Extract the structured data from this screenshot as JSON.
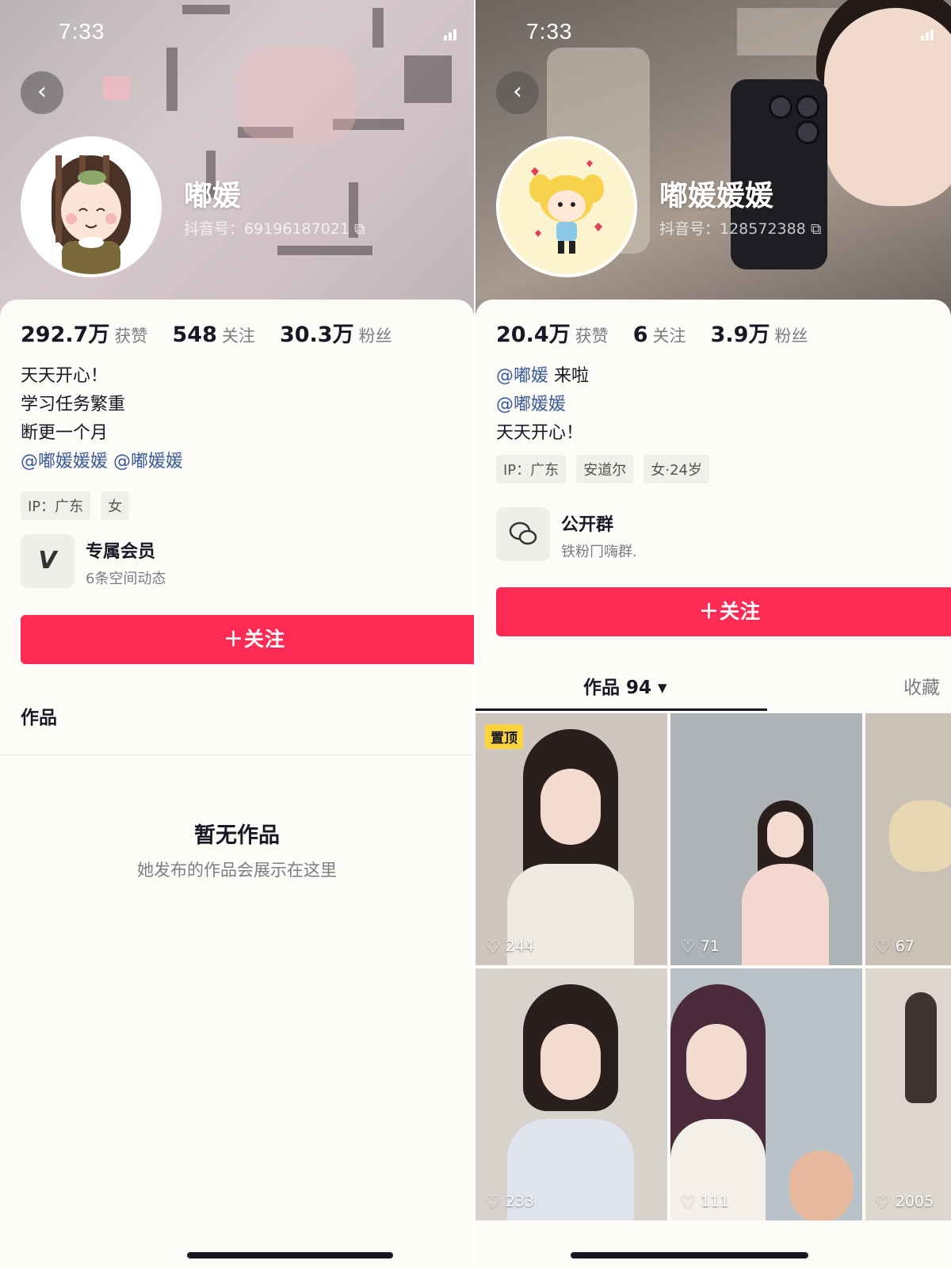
{
  "left": {
    "status_time": "7:33",
    "nickname": "嘟媛",
    "douyin_id": "抖音号：69196187021",
    "stats": [
      {
        "num": "292.7万",
        "label": "获赞"
      },
      {
        "num": "548",
        "label": "关注"
      },
      {
        "num": "30.3万",
        "label": "粉丝"
      }
    ],
    "bio": [
      "天天开心！",
      "学习任务繁重",
      "断更一个月"
    ],
    "mentions": [
      "@嘟媛媛媛",
      "@嘟媛媛"
    ],
    "tags": [
      "IP：广东",
      "女"
    ],
    "feature": {
      "icon": "V",
      "title": "专属会员",
      "subtitle": "6条空间动态"
    },
    "follow_label": "＋关注",
    "works_title": "作品",
    "empty_title": "暂无作品",
    "empty_subtitle": "她发布的作品会展示在这里"
  },
  "right": {
    "status_time": "7:33",
    "nickname": "嘟媛媛媛",
    "douyin_id": "抖音号：128572388",
    "stats": [
      {
        "num": "20.4万",
        "label": "获赞"
      },
      {
        "num": "6",
        "label": "关注"
      },
      {
        "num": "3.9万",
        "label": "粉丝"
      }
    ],
    "bio_mention_1": "@嘟媛",
    "bio_text_1": " 来啦",
    "bio_mention_2": "@嘟媛媛",
    "bio_text_3": "天天开心！",
    "tags": [
      "IP：广东",
      "安道尔",
      "女·24岁"
    ],
    "feature": {
      "title": "公开群",
      "subtitle": "铁粉冂嗨群."
    },
    "follow_label": "＋关注",
    "tab_works": "作品 94 ▾",
    "tab_favorites": "收藏",
    "pinned_label": "置顶",
    "videos": [
      {
        "likes": "244",
        "pinned": true
      },
      {
        "likes": "71"
      },
      {
        "likes": "67"
      },
      {
        "likes": "233"
      },
      {
        "likes": "111"
      },
      {
        "likes": "2005"
      }
    ]
  },
  "colors": {
    "accent": "#fe2c55",
    "mention": "#3a5a9a",
    "pinned": "#fcd33a"
  }
}
